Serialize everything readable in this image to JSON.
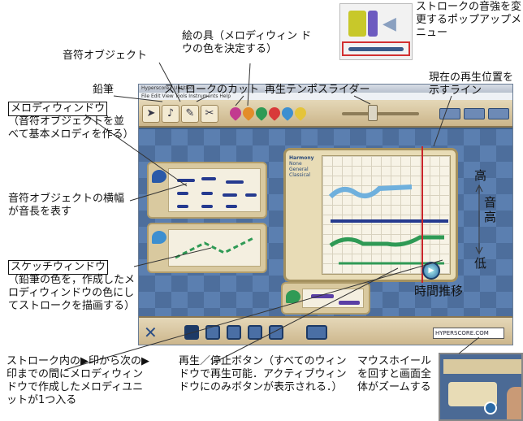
{
  "annotations": {
    "palette": "絵の具（メロディウィン ドウの色を決定する）",
    "note_object": "音符オブジェクト",
    "pencil": "鉛筆",
    "stroke_cut": "ストロークのカット",
    "tempo_slider": "再生テンポスライダー",
    "popup_menu": "ストロークの音強を変更するポップアップメニュー",
    "playline": "現在の再生位置を示すライン",
    "melody_window_title": "メロディウィンドウ",
    "melody_window_desc": "（音符オブジェクトを並べて基本メロディを作る）",
    "note_width": "音符オブジェクトの横幅が音長を表す",
    "sketch_window_title": "スケッチウィンドウ",
    "sketch_window_desc": "（鉛筆の色を，作成したメロディウィンドウの色にしてストロークを描画する）",
    "high": "高",
    "pitch": "音高",
    "low": "低",
    "time": "時間推移",
    "stroke_units": "ストローク内の▶印から次の▶印までの間にメロディウィンドウで作成したメロディユニットが1つ入る",
    "play_stop": "再生／停止ボタン（すべてのウィンドウで再生可能．アクティブウィンドウにのみボタンが表示される．）",
    "mouse_wheel": "マウスホイールを回すと画面全体がズームする"
  },
  "app": {
    "title": "Hyperscore - Untitled",
    "menu": "File Edit View Tools Instruments Help",
    "harmony_title": "Harmony",
    "harmony_options": [
      "None",
      "General",
      "Classical"
    ],
    "logo": "HYPERSCORE.COM"
  },
  "colors": {
    "blue": "#3d8fd0",
    "green": "#2f9a55",
    "navy": "#253a8f",
    "purple": "#5a3fa5"
  }
}
